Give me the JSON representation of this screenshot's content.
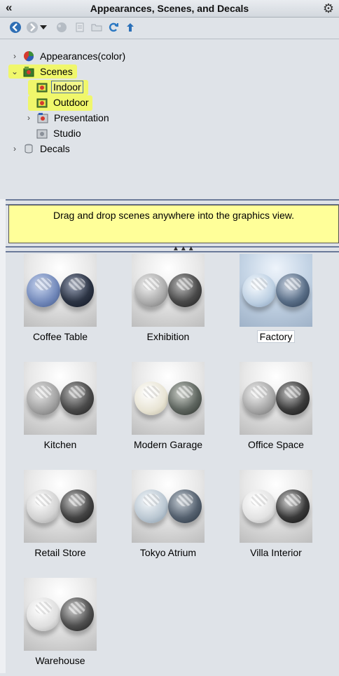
{
  "window": {
    "title": "Appearances, Scenes, and Decals",
    "collapse_glyph": "«",
    "gear_glyph": "⚙"
  },
  "toolbar": {
    "buttons": [
      {
        "name": "back-icon",
        "glyph": "◀"
      },
      {
        "name": "forward-icon",
        "glyph": "▶"
      },
      {
        "name": "history-dropdown-icon",
        "glyph": "▾"
      },
      {
        "name": "add-appearance-icon",
        "glyph": "◆"
      },
      {
        "name": "add-file-icon",
        "glyph": "▤"
      },
      {
        "name": "open-folder-icon",
        "glyph": "▭"
      },
      {
        "name": "refresh-icon",
        "glyph": "⟳"
      },
      {
        "name": "up-level-icon",
        "glyph": "↑"
      }
    ]
  },
  "tree": {
    "items": [
      {
        "label": "Appearances(color)",
        "expanded": false,
        "level": 0,
        "icon": "color-ball-icon"
      },
      {
        "label": "Scenes",
        "expanded": true,
        "level": 0,
        "icon": "scene-folder-icon",
        "highlighted": true
      },
      {
        "label": "Indoor",
        "level": 1,
        "icon": "scene-folder-icon",
        "selected": true,
        "highlighted": true
      },
      {
        "label": "Outdoor",
        "level": 1,
        "icon": "scene-folder-icon",
        "highlighted": true
      },
      {
        "label": "Presentation",
        "expanded": false,
        "level": 1,
        "icon": "scene-folder-icon"
      },
      {
        "label": "Studio",
        "level": 1,
        "icon": "scene-folder-icon"
      },
      {
        "label": "Decals",
        "expanded": false,
        "level": 0,
        "icon": "decal-icon"
      }
    ],
    "highlight_color": "#f0f76b"
  },
  "hint": {
    "text": "Drag and drop scenes anywhere into the graphics view.",
    "background": "#ffff99"
  },
  "gallery": {
    "items": [
      {
        "label": "Coffee Table",
        "theme": "blue-dark"
      },
      {
        "label": "Exhibition",
        "theme": "grey"
      },
      {
        "label": "Factory",
        "theme": "bluebg",
        "selected": true
      },
      {
        "label": "Kitchen",
        "theme": "grey"
      },
      {
        "label": "Modern Garage",
        "theme": "cream"
      },
      {
        "label": "Office Space",
        "theme": "grey"
      },
      {
        "label": "Retail Store",
        "theme": "white"
      },
      {
        "label": "Tokyo Atrium",
        "theme": "bluegrey"
      },
      {
        "label": "Villa Interior",
        "theme": "white"
      },
      {
        "label": "Warehouse",
        "theme": "white"
      }
    ]
  }
}
